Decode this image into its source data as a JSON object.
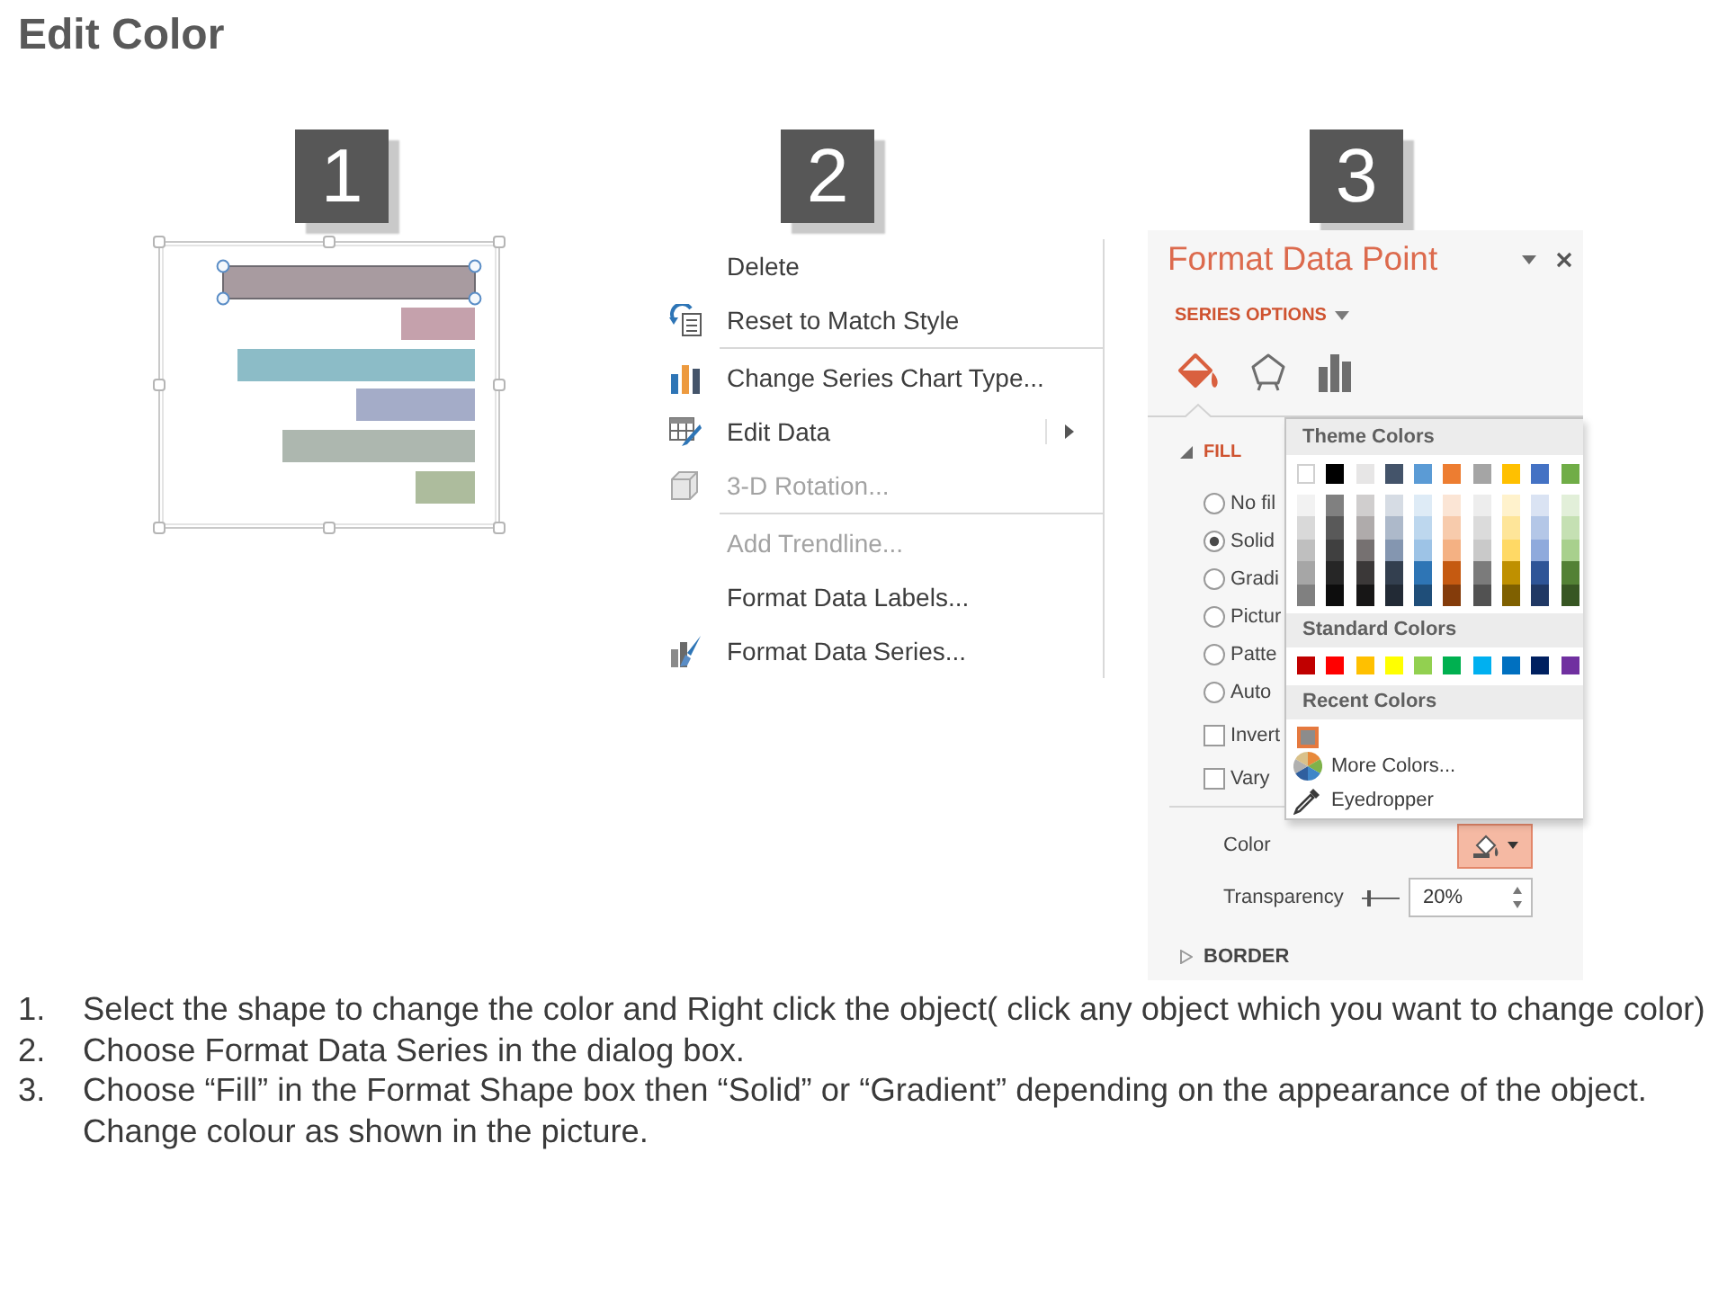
{
  "title": "Edit Color",
  "panels": [
    {
      "kind": "chart",
      "badge": "1",
      "bars": [
        {
          "color": "#a89ba0",
          "selected": true
        },
        {
          "color": "#c5a1ac",
          "selected": false
        },
        {
          "color": "#8cbcc7",
          "selected": false
        },
        {
          "color": "#a4acc8",
          "selected": false
        },
        {
          "color": "#adb7af",
          "selected": false
        },
        {
          "color": "#adbc9d",
          "selected": false
        }
      ]
    },
    {
      "kind": "menu",
      "badge": "2",
      "groups": [
        {
          "items": [
            {
              "label": "Delete",
              "disabled": false,
              "submenu": false
            },
            {
              "label": "Reset to Match Style",
              "disabled": false,
              "submenu": false
            }
          ]
        },
        {
          "items": [
            {
              "label": "Change Series Chart Type...",
              "disabled": false,
              "submenu": false
            },
            {
              "label": "Edit Data",
              "disabled": false,
              "submenu": true
            },
            {
              "label": "3-D Rotation...",
              "disabled": true,
              "submenu": false
            }
          ]
        },
        {
          "items": [
            {
              "label": "Add Trendline...",
              "disabled": true,
              "submenu": false
            },
            {
              "label": "Format Data Labels...",
              "disabled": false,
              "submenu": false
            },
            {
              "label": "Format Data Series...",
              "disabled": false,
              "submenu": false
            }
          ]
        }
      ]
    },
    {
      "kind": "pane",
      "badge": "3",
      "title": "Format Data Point",
      "options_label": "SERIES OPTIONS",
      "tabs": [
        {
          "selected": true
        },
        {
          "selected": false
        },
        {
          "selected": false
        }
      ],
      "fill": {
        "label": "FILL",
        "expanded": true,
        "options": [
          {
            "label": "No fil",
            "selected": false
          },
          {
            "label": "Solid",
            "selected": true
          },
          {
            "label": "Gradi",
            "selected": false
          },
          {
            "label": "Pictur",
            "selected": false
          },
          {
            "label": "Patte",
            "selected": false
          },
          {
            "label": "Auto",
            "selected": false
          }
        ],
        "checkboxes": [
          {
            "label": "Invert",
            "checked": false
          },
          {
            "label": "Vary",
            "checked": false
          }
        ],
        "color": {
          "label": "Color",
          "expanded": true
        },
        "transparency": {
          "label": "Transparency",
          "level": 0.2,
          "value": "20%"
        }
      },
      "border": {
        "label": "BORDER",
        "expanded": false
      },
      "color_picker": {
        "theme_label": "Theme Colors",
        "theme_colors": [
          {
            "color": "#ffffff",
            "shades": [
              {
                "color": "#f2f2f2"
              },
              {
                "color": "#d9d9d9"
              },
              {
                "color": "#bfbfbf"
              },
              {
                "color": "#a6a6a6"
              },
              {
                "color": "#808080"
              }
            ]
          },
          {
            "color": "#000000",
            "shades": [
              {
                "color": "#808080"
              },
              {
                "color": "#595959"
              },
              {
                "color": "#404040"
              },
              {
                "color": "#262626"
              },
              {
                "color": "#0d0d0d"
              }
            ]
          },
          {
            "color": "#e7e6e6",
            "shades": [
              {
                "color": "#d0cece"
              },
              {
                "color": "#afabab"
              },
              {
                "color": "#767171"
              },
              {
                "color": "#3b3838"
              },
              {
                "color": "#171616"
              }
            ]
          },
          {
            "color": "#44546a",
            "shades": [
              {
                "color": "#d6dce4"
              },
              {
                "color": "#adb9ca"
              },
              {
                "color": "#8496b0"
              },
              {
                "color": "#333f4f"
              },
              {
                "color": "#222a35"
              }
            ]
          },
          {
            "color": "#5b9bd5",
            "shades": [
              {
                "color": "#deebf6"
              },
              {
                "color": "#bdd7ee"
              },
              {
                "color": "#9dc3e6"
              },
              {
                "color": "#2e75b5"
              },
              {
                "color": "#1f4e79"
              }
            ]
          },
          {
            "color": "#ed7d31",
            "shades": [
              {
                "color": "#fbe5d5"
              },
              {
                "color": "#f7cbac"
              },
              {
                "color": "#f4b183"
              },
              {
                "color": "#c55a11"
              },
              {
                "color": "#843c0b"
              }
            ]
          },
          {
            "color": "#a5a5a5",
            "shades": [
              {
                "color": "#ededed"
              },
              {
                "color": "#dbdbdb"
              },
              {
                "color": "#c9c9c9"
              },
              {
                "color": "#7b7b7b"
              },
              {
                "color": "#525252"
              }
            ]
          },
          {
            "color": "#ffc000",
            "shades": [
              {
                "color": "#fff2cc"
              },
              {
                "color": "#fee599"
              },
              {
                "color": "#ffd965"
              },
              {
                "color": "#bf9000"
              },
              {
                "color": "#7f6000"
              }
            ]
          },
          {
            "color": "#4472c4",
            "shades": [
              {
                "color": "#dae3f3"
              },
              {
                "color": "#b4c7e7"
              },
              {
                "color": "#8faadc"
              },
              {
                "color": "#2f5597"
              },
              {
                "color": "#203864"
              }
            ]
          },
          {
            "color": "#70ad47",
            "shades": [
              {
                "color": "#e2efd9"
              },
              {
                "color": "#c5e0b3"
              },
              {
                "color": "#a8d08d"
              },
              {
                "color": "#538135"
              },
              {
                "color": "#375623"
              }
            ]
          }
        ],
        "standard_label": "Standard Colors",
        "standard_colors": [
          {
            "color": "#c00000"
          },
          {
            "color": "#ff0000"
          },
          {
            "color": "#ffc000"
          },
          {
            "color": "#ffff00"
          },
          {
            "color": "#92d050"
          },
          {
            "color": "#00b050"
          },
          {
            "color": "#00b0f0"
          },
          {
            "color": "#0070c0"
          },
          {
            "color": "#002060"
          },
          {
            "color": "#7030a0"
          }
        ],
        "recent_label": "Recent Colors",
        "recent_colors": [
          {
            "color": "#8c8c8c",
            "selected": true
          }
        ],
        "actions": [
          "More Colors...",
          "Eyedropper"
        ]
      }
    }
  ],
  "steps": [
    {
      "number": "1.",
      "text": "Select the shape to change the color and Right click the object( click any object which you want to change color)"
    },
    {
      "number": "2.",
      "text": "Choose Format Data Series in the dialog box."
    },
    {
      "number": "3.",
      "text": "Choose “Fill” in the Format Shape box then “Solid” or “Gradient” depending on the appearance of the object. Change colour as shown in the picture."
    }
  ]
}
